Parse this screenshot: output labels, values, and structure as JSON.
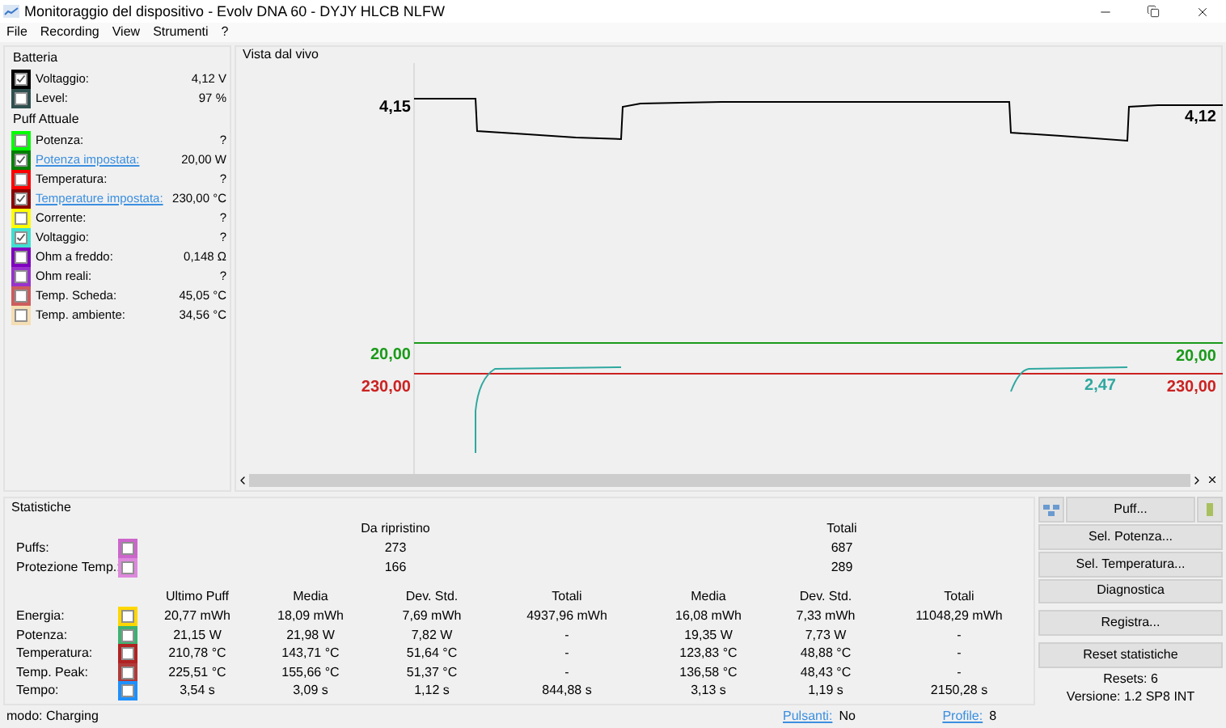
{
  "window": {
    "title": "Monitoraggio del dispositivo - Evolv DNA 60 - DYJY HLCB NLFW"
  },
  "menu": [
    "File",
    "Recording",
    "View",
    "Strumenti",
    "?"
  ],
  "battery": {
    "title": "Batteria",
    "rows": [
      {
        "label": "Voltaggio:",
        "value": "4,12 V",
        "color": "#000000",
        "checked": true,
        "link": false
      },
      {
        "label": "Level:",
        "value": "97 %",
        "color": "#2f4f4f",
        "checked": false,
        "link": false
      }
    ]
  },
  "current_puff": {
    "title": "Puff Attuale",
    "rows": [
      {
        "label": "Potenza:",
        "value": "?",
        "color": "#00ff00",
        "checked": false,
        "link": false
      },
      {
        "label": "Potenza impostata:",
        "value": "20,00 W",
        "color": "#008000",
        "checked": true,
        "link": true
      },
      {
        "label": "Temperatura:",
        "value": "?",
        "color": "#ff0000",
        "checked": false,
        "link": false
      },
      {
        "label": "Temperature impostata:",
        "value": "230,00 °C",
        "color": "#8b0000",
        "checked": true,
        "link": true
      },
      {
        "label": "Corrente:",
        "value": "?",
        "color": "#ffff00",
        "checked": false,
        "link": false
      },
      {
        "label": "Voltaggio:",
        "value": "?",
        "color": "#40e0d0",
        "checked": true,
        "link": false
      },
      {
        "label": "Ohm a freddo:",
        "value": "0,148 Ω",
        "color": "#8000c0",
        "checked": false,
        "link": false
      },
      {
        "label": "Ohm reali:",
        "value": "?",
        "color": "#9932cc",
        "checked": false,
        "link": false
      },
      {
        "label": "Temp. Scheda:",
        "value": "45,05 °C",
        "color": "#cd5c5c",
        "checked": false,
        "link": false
      },
      {
        "label": "Temp. ambiente:",
        "value": "34,56 °C",
        "color": "#f5deb3",
        "checked": false,
        "link": false
      }
    ]
  },
  "live_view": {
    "title": "Vista dal vivo",
    "traces": [
      {
        "kind": "voltage",
        "color": "#000000",
        "start_label": "4,15",
        "end_label": "4,12"
      },
      {
        "kind": "power_set",
        "color": "#1a9a1a",
        "start_label": "20,00",
        "end_label": "20,00"
      },
      {
        "kind": "temp_set",
        "color": "#cc2222",
        "start_label": "230,00",
        "end_label": "230,00"
      },
      {
        "kind": "puff_voltage",
        "color": "#2fa8a0",
        "end_label": "2,47"
      }
    ]
  },
  "stats": {
    "title": "Statistiche",
    "group_headers": [
      "Da ripristino",
      "Totali"
    ],
    "counters": [
      {
        "label": "Puffs:",
        "color": "#cc66cc",
        "checked": false,
        "since_reset": "273",
        "total": "687"
      },
      {
        "label": "Protezione Temp.:",
        "color": "#dd88dd",
        "checked": false,
        "since_reset": "166",
        "total": "289"
      }
    ],
    "columns": [
      "Ultimo Puff",
      "Media",
      "Dev. Std.",
      "Totali",
      "Media",
      "Dev. Std.",
      "Totali"
    ],
    "rows": [
      {
        "label": "Energia:",
        "color": "#ffd700",
        "checked": false,
        "cells": [
          "20,77 mWh",
          "18,09 mWh",
          "7,69 mWh",
          "4937,96 mWh",
          "16,08 mWh",
          "7,33 mWh",
          "11048,29 mWh"
        ]
      },
      {
        "label": "Potenza:",
        "color": "#3cb371",
        "checked": false,
        "cells": [
          "21,15 W",
          "21,98 W",
          "7,82 W",
          "-",
          "19,35 W",
          "7,73 W",
          "-"
        ]
      },
      {
        "label": "Temperatura:",
        "color": "#b22222",
        "checked": false,
        "cells": [
          "210,78 °C",
          "143,71 °C",
          "51,64 °C",
          "-",
          "123,83 °C",
          "48,88 °C",
          "-"
        ]
      },
      {
        "label": "Temp. Peak:",
        "color": "#b03a3a",
        "checked": false,
        "cells": [
          "225,51 °C",
          "155,66 °C",
          "51,37 °C",
          "-",
          "136,58 °C",
          "48,43 °C",
          "-"
        ]
      },
      {
        "label": "Tempo:",
        "color": "#1e90ff",
        "checked": false,
        "cells": [
          "3,54 s",
          "3,09 s",
          "1,12 s",
          "844,88 s",
          "3,13 s",
          "1,19 s",
          "2150,28 s"
        ]
      }
    ]
  },
  "actions": {
    "puff_button": "Puff...",
    "buttons": [
      "Sel. Potenza...",
      "Sel. Temperatura...",
      "Diagnostica",
      "Registra...",
      "Reset statistiche"
    ],
    "resets": "Resets: 6",
    "version": "Versione: 1.2 SP8 INT"
  },
  "status_bar": {
    "mode": "modo: Charging",
    "buttons_label": "Pulsanti:",
    "buttons_value": "No",
    "profile_label": "Profile:",
    "profile_value": "8"
  }
}
